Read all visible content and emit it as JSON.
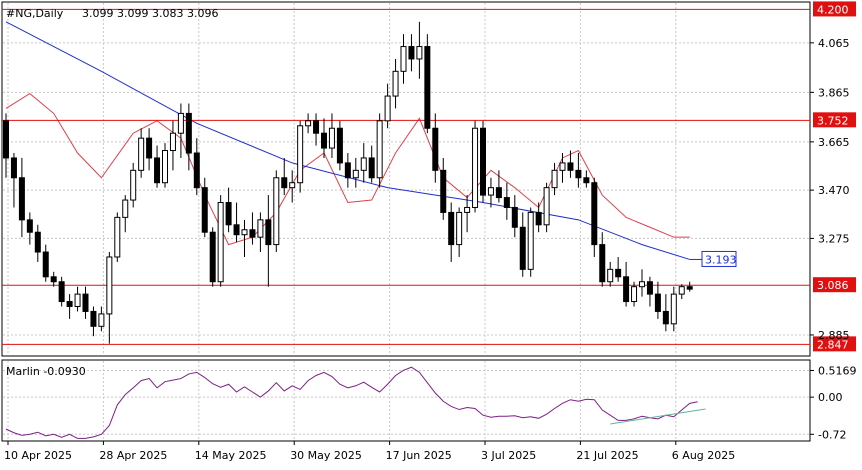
{
  "chart_data": {
    "type": "candlestick",
    "symbol": "#NG,Daily",
    "ohlc_header": "3.099 3.099 3.083 3.096",
    "colors": {
      "background": "#ffffff",
      "bull_fill": "#ffffff",
      "bear_fill": "#000000",
      "candle_stroke": "#000000",
      "grid": "#c8c8c8",
      "ma_line": "#1f2fd0",
      "envelope_line": "#e0404a",
      "level_line": "#e01010",
      "level_label_bg": "#e01010",
      "level_label_text": "#ffffff",
      "ma_label_border": "#1f2fd0",
      "ma_label_text": "#1f2fd0",
      "oscillator": "#7d1f86",
      "trendline": "#5cb89a"
    },
    "price_axis": {
      "min": 2.8,
      "max": 4.23,
      "ticks": [
        "4.065",
        "3.865",
        "3.665",
        "3.470",
        "3.275",
        "2.885"
      ],
      "tick_values": [
        4.065,
        3.865,
        3.665,
        3.47,
        3.275,
        2.885
      ]
    },
    "x_axis": {
      "labels": [
        "10 Apr 2025",
        "28 Apr 2025",
        "14 May 2025",
        "30 May 2025",
        "17 Jun 2025",
        "3 Jul 2025",
        "21 Jul 2025",
        "6 Aug 2025"
      ],
      "label_index": [
        0,
        12,
        24,
        36,
        48,
        60,
        72,
        84
      ]
    },
    "levels": [
      {
        "value": 4.2,
        "label": "4.200"
      },
      {
        "value": 3.752,
        "label": "3.752"
      },
      {
        "value": 3.086,
        "label": "3.086"
      },
      {
        "value": 2.847,
        "label": "2.847"
      }
    ],
    "ma_label": "3.193",
    "candles": [
      [
        3.75,
        3.78,
        3.52,
        3.6
      ],
      [
        3.6,
        3.62,
        3.4,
        3.52
      ],
      [
        3.52,
        3.6,
        3.28,
        3.35
      ],
      [
        3.35,
        3.38,
        3.25,
        3.3
      ],
      [
        3.3,
        3.33,
        3.18,
        3.22
      ],
      [
        3.22,
        3.25,
        3.1,
        3.12
      ],
      [
        3.12,
        3.14,
        3.08,
        3.1
      ],
      [
        3.1,
        3.12,
        3.0,
        3.02
      ],
      [
        3.02,
        3.05,
        2.95,
        3.0
      ],
      [
        3.0,
        3.08,
        2.98,
        3.05
      ],
      [
        3.05,
        3.08,
        2.95,
        2.98
      ],
      [
        2.98,
        3.0,
        2.88,
        2.92
      ],
      [
        2.92,
        3.0,
        2.9,
        2.97
      ],
      [
        2.97,
        3.22,
        2.85,
        3.2
      ],
      [
        3.2,
        3.38,
        3.18,
        3.36
      ],
      [
        3.36,
        3.45,
        3.3,
        3.43
      ],
      [
        3.43,
        3.58,
        3.4,
        3.55
      ],
      [
        3.55,
        3.72,
        3.52,
        3.68
      ],
      [
        3.68,
        3.72,
        3.55,
        3.6
      ],
      [
        3.6,
        3.65,
        3.48,
        3.5
      ],
      [
        3.5,
        3.66,
        3.48,
        3.63
      ],
      [
        3.63,
        3.75,
        3.55,
        3.7
      ],
      [
        3.7,
        3.82,
        3.6,
        3.78
      ],
      [
        3.78,
        3.82,
        3.55,
        3.62
      ],
      [
        3.62,
        3.68,
        3.45,
        3.48
      ],
      [
        3.48,
        3.52,
        3.28,
        3.3
      ],
      [
        3.3,
        3.32,
        3.08,
        3.1
      ],
      [
        3.1,
        3.45,
        3.08,
        3.42
      ],
      [
        3.42,
        3.48,
        3.3,
        3.33
      ],
      [
        3.33,
        3.42,
        3.26,
        3.29
      ],
      [
        3.29,
        3.35,
        3.2,
        3.31
      ],
      [
        3.31,
        3.38,
        3.25,
        3.28
      ],
      [
        3.28,
        3.38,
        3.22,
        3.35
      ],
      [
        3.35,
        3.45,
        3.08,
        3.25
      ],
      [
        3.25,
        3.55,
        3.22,
        3.52
      ],
      [
        3.52,
        3.6,
        3.45,
        3.48
      ],
      [
        3.48,
        3.55,
        3.42,
        3.5
      ],
      [
        3.5,
        3.75,
        3.46,
        3.73
      ],
      [
        3.73,
        3.78,
        3.7,
        3.75
      ],
      [
        3.75,
        3.78,
        3.65,
        3.7
      ],
      [
        3.7,
        3.76,
        3.6,
        3.64
      ],
      [
        3.64,
        3.78,
        3.6,
        3.72
      ],
      [
        3.72,
        3.75,
        3.55,
        3.58
      ],
      [
        3.58,
        3.62,
        3.48,
        3.52
      ],
      [
        3.52,
        3.6,
        3.48,
        3.55
      ],
      [
        3.55,
        3.66,
        3.5,
        3.6
      ],
      [
        3.6,
        3.65,
        3.5,
        3.52
      ],
      [
        3.52,
        3.78,
        3.48,
        3.75
      ],
      [
        3.75,
        3.9,
        3.72,
        3.85
      ],
      [
        3.85,
        4.0,
        3.8,
        3.95
      ],
      [
        3.95,
        4.1,
        3.9,
        4.05
      ],
      [
        4.05,
        4.1,
        3.95,
        4.0
      ],
      [
        4.0,
        4.15,
        3.92,
        4.05
      ],
      [
        4.05,
        4.1,
        3.7,
        3.72
      ],
      [
        3.72,
        3.78,
        3.5,
        3.55
      ],
      [
        3.55,
        3.6,
        3.35,
        3.38
      ],
      [
        3.38,
        3.42,
        3.18,
        3.25
      ],
      [
        3.25,
        3.4,
        3.2,
        3.38
      ],
      [
        3.38,
        3.45,
        3.3,
        3.4
      ],
      [
        3.4,
        3.75,
        3.38,
        3.72
      ],
      [
        3.72,
        3.75,
        3.42,
        3.45
      ],
      [
        3.45,
        3.52,
        3.4,
        3.48
      ],
      [
        3.48,
        3.55,
        3.42,
        3.44
      ],
      [
        3.44,
        3.5,
        3.35,
        3.4
      ],
      [
        3.4,
        3.45,
        3.28,
        3.32
      ],
      [
        3.32,
        3.38,
        3.12,
        3.15
      ],
      [
        3.15,
        3.4,
        3.12,
        3.38
      ],
      [
        3.38,
        3.42,
        3.3,
        3.33
      ],
      [
        3.33,
        3.5,
        3.3,
        3.48
      ],
      [
        3.48,
        3.58,
        3.45,
        3.55
      ],
      [
        3.55,
        3.62,
        3.5,
        3.58
      ],
      [
        3.58,
        3.63,
        3.52,
        3.55
      ],
      [
        3.55,
        3.62,
        3.48,
        3.52
      ],
      [
        3.52,
        3.55,
        3.48,
        3.5
      ],
      [
        3.5,
        3.52,
        3.2,
        3.25
      ],
      [
        3.25,
        3.3,
        3.08,
        3.1
      ],
      [
        3.1,
        3.18,
        3.08,
        3.15
      ],
      [
        3.15,
        3.2,
        3.1,
        3.12
      ],
      [
        3.12,
        3.18,
        3.0,
        3.02
      ],
      [
        3.02,
        3.1,
        3.0,
        3.08
      ],
      [
        3.08,
        3.15,
        3.04,
        3.1
      ],
      [
        3.1,
        3.12,
        3.0,
        3.05
      ],
      [
        3.05,
        3.1,
        2.95,
        2.98
      ],
      [
        2.98,
        3.05,
        2.9,
        2.93
      ],
      [
        2.93,
        3.08,
        2.9,
        3.05
      ],
      [
        3.05,
        3.09,
        3.03,
        3.08
      ],
      [
        3.08,
        3.1,
        3.06,
        3.07
      ]
    ],
    "ma": [
      [
        0,
        4.15
      ],
      [
        12,
        3.95
      ],
      [
        24,
        3.74
      ],
      [
        36,
        3.58
      ],
      [
        48,
        3.48
      ],
      [
        60,
        3.42
      ],
      [
        72,
        3.35
      ],
      [
        80,
        3.25
      ],
      [
        86,
        3.19
      ]
    ],
    "envelope": [
      [
        0,
        3.8
      ],
      [
        3,
        3.86
      ],
      [
        6,
        3.78
      ],
      [
        9,
        3.62
      ],
      [
        12,
        3.52
      ],
      [
        16,
        3.7
      ],
      [
        19,
        3.75
      ],
      [
        22,
        3.68
      ],
      [
        25,
        3.45
      ],
      [
        28,
        3.25
      ],
      [
        31,
        3.28
      ],
      [
        34,
        3.38
      ],
      [
        37,
        3.55
      ],
      [
        40,
        3.62
      ],
      [
        43,
        3.42
      ],
      [
        46,
        3.43
      ],
      [
        49,
        3.62
      ],
      [
        52,
        3.76
      ],
      [
        55,
        3.52
      ],
      [
        58,
        3.44
      ],
      [
        61,
        3.55
      ],
      [
        64,
        3.48
      ],
      [
        67,
        3.4
      ],
      [
        70,
        3.6
      ],
      [
        72,
        3.63
      ],
      [
        75,
        3.45
      ],
      [
        78,
        3.36
      ],
      [
        81,
        3.32
      ],
      [
        84,
        3.28
      ],
      [
        86,
        3.28
      ]
    ],
    "oscillator": {
      "label": "Marlin -0.0930",
      "ticks": [
        "0.5169",
        "0.00",
        "-0.72"
      ],
      "tick_values": [
        0.5169,
        0.0,
        -0.72
      ],
      "min": -0.85,
      "max": 0.72,
      "values": [
        -0.62,
        -0.69,
        -0.74,
        -0.72,
        -0.68,
        -0.75,
        -0.72,
        -0.78,
        -0.72,
        -0.8,
        -0.8,
        -0.77,
        -0.72,
        -0.55,
        -0.15,
        0.05,
        0.18,
        0.32,
        0.36,
        0.18,
        0.3,
        0.33,
        0.36,
        0.45,
        0.48,
        0.38,
        0.26,
        0.19,
        0.25,
        0.1,
        0.2,
        0.1,
        0.0,
        0.12,
        0.28,
        0.12,
        0.22,
        0.15,
        0.32,
        0.42,
        0.48,
        0.4,
        0.25,
        0.18,
        0.22,
        0.29,
        0.19,
        0.1,
        0.25,
        0.42,
        0.52,
        0.58,
        0.48,
        0.28,
        0.08,
        -0.08,
        -0.18,
        -0.24,
        -0.2,
        -0.22,
        -0.35,
        -0.39,
        -0.37,
        -0.37,
        -0.36,
        -0.4,
        -0.38,
        -0.41,
        -0.33,
        -0.22,
        -0.12,
        -0.05,
        -0.08,
        -0.04,
        -0.05,
        -0.25,
        -0.35,
        -0.45,
        -0.45,
        -0.42,
        -0.37,
        -0.4,
        -0.42,
        -0.35,
        -0.38,
        -0.25,
        -0.12,
        -0.09
      ],
      "trendline": [
        [
          76,
          -0.52
        ],
        [
          88,
          -0.23
        ]
      ]
    }
  }
}
